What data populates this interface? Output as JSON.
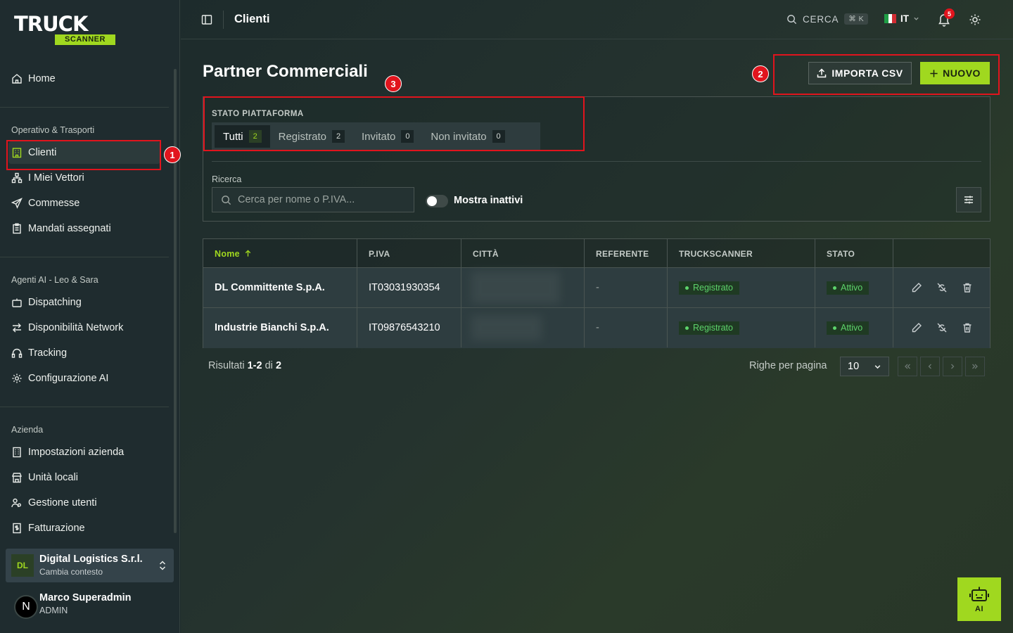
{
  "brand": {
    "logo_main": "TRUCK",
    "logo_sub": "SCANNER",
    "accent": "#a0d81f"
  },
  "sidebar": {
    "home": {
      "label": "Home",
      "icon": "home-icon"
    },
    "sections": [
      {
        "title": "Operativo & Trasporti",
        "items": [
          {
            "label": "Clienti",
            "icon": "building-icon",
            "active": true
          },
          {
            "label": "I Miei Vettori",
            "icon": "network-icon"
          },
          {
            "label": "Commesse",
            "icon": "send-icon"
          },
          {
            "label": "Mandati assegnati",
            "icon": "clipboard-icon"
          }
        ]
      },
      {
        "title": "Agenti AI - Leo & Sara",
        "items": [
          {
            "label": "Dispatching",
            "icon": "bot-icon"
          },
          {
            "label": "Disponibilità Network",
            "icon": "arrows-icon"
          },
          {
            "label": "Tracking",
            "icon": "headset-icon"
          },
          {
            "label": "Configurazione AI",
            "icon": "gear-icon"
          }
        ]
      },
      {
        "title": "Azienda",
        "items": [
          {
            "label": "Impostazioni azienda",
            "icon": "building-office-icon"
          },
          {
            "label": "Unità locali",
            "icon": "store-icon"
          },
          {
            "label": "Gestione utenti",
            "icon": "users-icon"
          },
          {
            "label": "Fatturazione",
            "icon": "invoice-icon"
          }
        ]
      }
    ],
    "company": {
      "initials": "DL",
      "name": "Digital Logistics S.r.l.",
      "subtitle": "Cambia contesto"
    },
    "user": {
      "initial": "N",
      "name": "Marco Superadmin",
      "role": "ADMIN"
    }
  },
  "topbar": {
    "title": "Clienti",
    "search_label": "CERCA",
    "search_kbd": "⌘ K",
    "lang": "IT",
    "notifications": "5"
  },
  "page": {
    "title": "Partner Commerciali",
    "import_label": "IMPORTA CSV",
    "new_label": "NUOVO"
  },
  "filters": {
    "status_label": "STATO PIATTAFORMA",
    "tabs": [
      {
        "label": "Tutti",
        "count": "2"
      },
      {
        "label": "Registrato",
        "count": "2"
      },
      {
        "label": "Invitato",
        "count": "0"
      },
      {
        "label": "Non invitato",
        "count": "0"
      }
    ],
    "search_label": "Ricerca",
    "search_placeholder": "Cerca per nome o P.IVA...",
    "toggle_label": "Mostra inattivi"
  },
  "table": {
    "headers": [
      "Nome",
      "P.IVA",
      "CITTÀ",
      "REFERENTE",
      "TRUCKSCANNER",
      "STATO"
    ],
    "rows": [
      {
        "nome": "DL Committente S.p.A.",
        "piva": "IT03031930354",
        "referente": "-",
        "truckscanner": "Registrato",
        "stato": "Attivo"
      },
      {
        "nome": "Industrie Bianchi S.p.A.",
        "piva": "IT09876543210",
        "referente": "-",
        "truckscanner": "Registrato",
        "stato": "Attivo"
      }
    ]
  },
  "pagination": {
    "results_prefix": "Risultati",
    "results_range": "1-2",
    "results_of": "di",
    "results_total": "2",
    "rows_per_page_label": "Righe per pagina",
    "rows_per_page": "10"
  },
  "annotations": [
    "1",
    "2",
    "3"
  ],
  "ai_button": {
    "label": "AI"
  },
  "colors": {
    "highlight": "#e1141d",
    "success": "#5dd36b"
  }
}
